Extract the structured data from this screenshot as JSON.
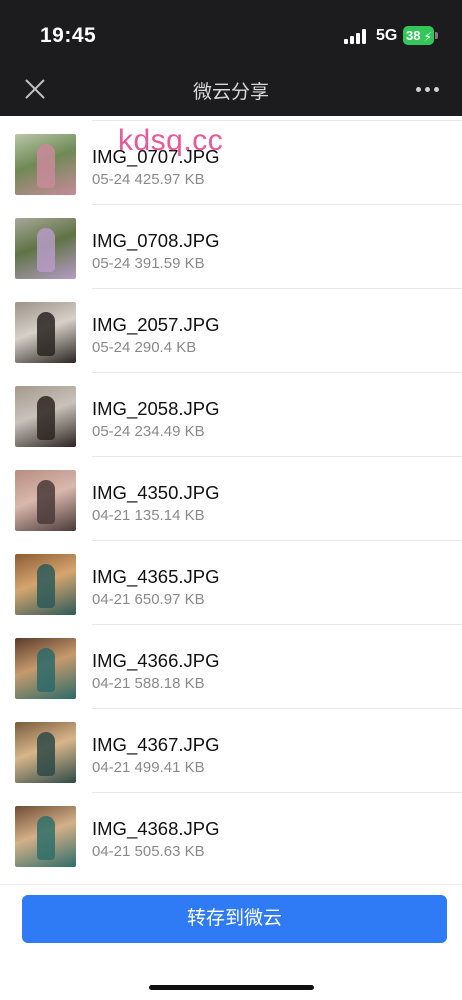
{
  "status_bar": {
    "time": "19:45",
    "network": "5G",
    "battery": "38"
  },
  "navbar": {
    "title": "微云分享",
    "close_icon": "close-icon",
    "more_icon": "more-dots-icon"
  },
  "watermark": "kdsq.cc",
  "files": [
    {
      "name": "IMG_0707.JPG",
      "meta": "05-24 425.97 KB",
      "thumb_colors": [
        "#6f8a55",
        "#b9c6a8",
        "#c98a9a"
      ]
    },
    {
      "name": "IMG_0708.JPG",
      "meta": "05-24 391.59 KB",
      "thumb_colors": [
        "#5f7445",
        "#a8a89a",
        "#b79bc7"
      ]
    },
    {
      "name": "IMG_2057.JPG",
      "meta": "05-24 290.4 KB",
      "thumb_colors": [
        "#d6d0c8",
        "#9c9288",
        "#2a2522"
      ]
    },
    {
      "name": "IMG_2058.JPG",
      "meta": "05-24 234.49 KB",
      "thumb_colors": [
        "#c9c2bb",
        "#a4988c",
        "#2b2421"
      ]
    },
    {
      "name": "IMG_4350.JPG",
      "meta": "04-21 135.14 KB",
      "thumb_colors": [
        "#d9b8ac",
        "#b78d80",
        "#4a3a38"
      ]
    },
    {
      "name": "IMG_4365.JPG",
      "meta": "04-21 650.97 KB",
      "thumb_colors": [
        "#d6a56e",
        "#8c5b34",
        "#2d5a5a"
      ]
    },
    {
      "name": "IMG_4366.JPG",
      "meta": "04-21 588.18 KB",
      "thumb_colors": [
        "#c79a6c",
        "#5a3b2a",
        "#2c6a68"
      ]
    },
    {
      "name": "IMG_4367.JPG",
      "meta": "04-21 499.41 KB",
      "thumb_colors": [
        "#d8b58a",
        "#7a5a3c",
        "#2e4a48"
      ]
    },
    {
      "name": "IMG_4368.JPG",
      "meta": "04-21 505.63 KB",
      "thumb_colors": [
        "#d4b088",
        "#6e4d33",
        "#2f6e6a"
      ]
    }
  ],
  "actions": {
    "save_label": "转存到微云"
  }
}
